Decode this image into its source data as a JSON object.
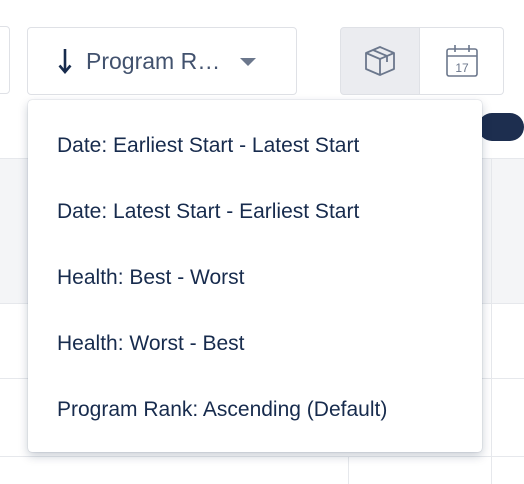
{
  "sort": {
    "selected_label": "Program R…",
    "icons": {
      "direction": "arrow-down-icon",
      "toggle": "chevron-down-icon"
    }
  },
  "view_toggle": {
    "items": [
      {
        "icon": "package-box-icon",
        "active": true
      },
      {
        "icon": "calendar-icon",
        "active": false,
        "day": "17"
      }
    ]
  },
  "sort_menu": {
    "options": [
      {
        "label": "Date: Earliest Start - Latest Start"
      },
      {
        "label": "Date: Latest Start - Earliest Start"
      },
      {
        "label": "Health: Best - Worst"
      },
      {
        "label": "Health: Worst - Best"
      },
      {
        "label": "Program Rank: Ascending (Default)"
      }
    ]
  },
  "colors": {
    "text_primary": "#172b4d",
    "text_secondary": "#42526e",
    "border": "#dfe1e6",
    "active_bg": "#ebecf0",
    "timeline_handle": "#1d2e4f"
  }
}
